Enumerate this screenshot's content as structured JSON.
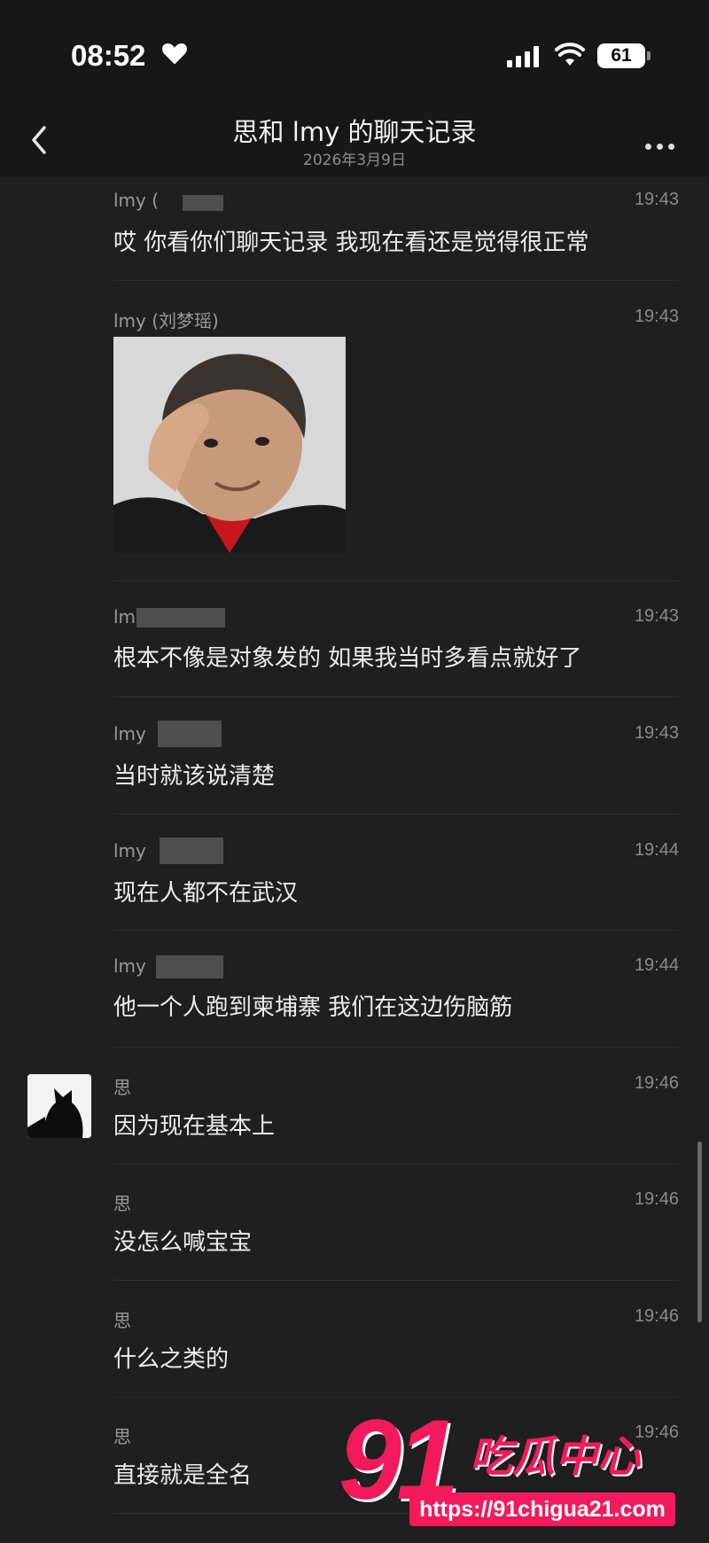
{
  "status_bar": {
    "time": "08:52",
    "battery": "61"
  },
  "header": {
    "title": "思和 lmy 的聊天记录",
    "date": "2026年3月9日"
  },
  "messages": [
    {
      "sender": "lmy (",
      "time": "19:43",
      "text": "哎 你看你们聊天记录 我现在看还是觉得很正常"
    },
    {
      "sender": "lmy (刘梦瑶)",
      "time": "19:43",
      "text": "",
      "image": "meme-photo"
    },
    {
      "sender": "lm",
      "time": "19:43",
      "text": "根本不像是对象发的 如果我当时多看点就好了"
    },
    {
      "sender": "lmy",
      "time": "19:43",
      "text": "当时就该说清楚"
    },
    {
      "sender": "lmy",
      "time": "19:44",
      "text": "现在人都不在武汉"
    },
    {
      "sender": "lmy",
      "time": "19:44",
      "text": "他一个人跑到柬埔寨 我们在这边伤脑筋"
    },
    {
      "sender": "思",
      "time": "19:46",
      "text": "因为现在基本上"
    },
    {
      "sender": "思",
      "time": "19:46",
      "text": "没怎么喊宝宝"
    },
    {
      "sender": "思",
      "time": "19:46",
      "text": "什么之类的"
    },
    {
      "sender": "思",
      "time": "19:46",
      "text": "直接就是全名"
    }
  ],
  "watermark": {
    "number": "91",
    "brand": "吃瓜中心",
    "url": "https://91chigua21.com"
  },
  "colors": {
    "background": "#1f1f1f",
    "header": "#171717",
    "watermark": "#f21a5c"
  }
}
